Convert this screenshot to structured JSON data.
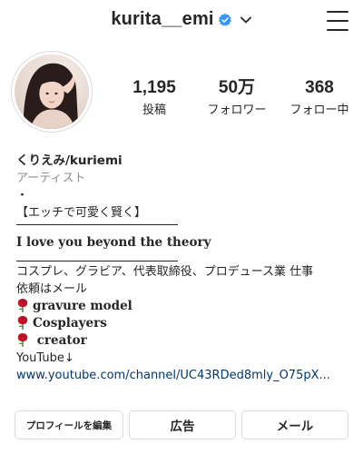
{
  "header": {
    "username": "kurita__emi",
    "verified_color": "#3897f0",
    "verified_icon": "verified-badge-icon",
    "chevron_icon": "chevron-down-icon",
    "menu_icon": "hamburger-menu-icon"
  },
  "stats": {
    "posts": {
      "value": "1,195",
      "label": "投稿"
    },
    "followers": {
      "value": "50万",
      "label": "フォロワー"
    },
    "following": {
      "value": "368",
      "label": "フォロー中"
    }
  },
  "bio": {
    "name": "くりえみ/kuriemi",
    "category": "アーティスト",
    "dot": "・",
    "tagline": "【エッチで可愛く賢く】",
    "love": "I love you beyond the theory",
    "desc1": "コスプレ、グラビア、代表取締役、プロデュース業 仕事",
    "desc2": "依頼はメール",
    "item1": "gravure model",
    "item2": "Cosplayers",
    "item3": "creator",
    "youtube": "YouTube↓",
    "link": "www.youtube.com/channel/UC43RDed8mly_O75pX..."
  },
  "buttons": {
    "edit": "プロフィールを編集",
    "ad": "広告",
    "mail": "メール"
  },
  "colors": {
    "text": "#262626",
    "muted": "#8e8e8e",
    "link": "#00376b",
    "border": "#dbdbdb",
    "rose": "#c0152a"
  }
}
